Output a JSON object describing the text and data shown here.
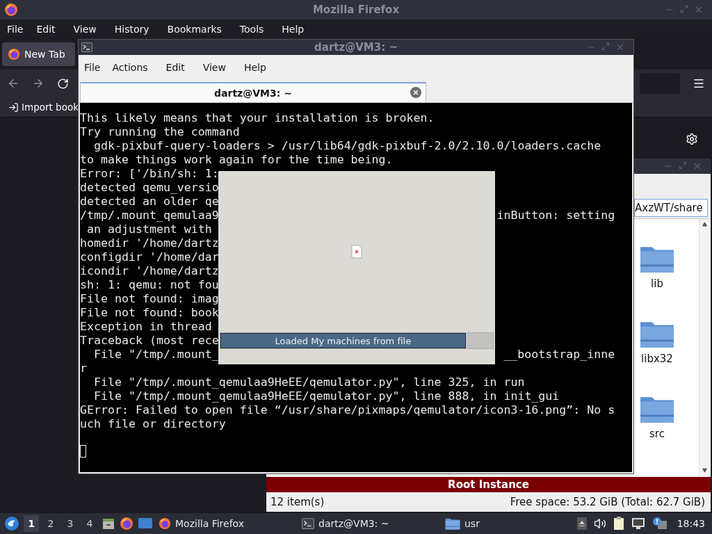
{
  "firefox": {
    "title": "Mozilla Firefox",
    "menu": [
      "File",
      "Edit",
      "View",
      "History",
      "Bookmarks",
      "Tools",
      "Help"
    ],
    "tab": {
      "label": "New Tab"
    },
    "bookmark": "Import book"
  },
  "terminal": {
    "title": "dartz@VM3: ~",
    "menu": [
      "File",
      "Actions",
      "Edit",
      "View",
      "Help"
    ],
    "tab": {
      "title": "dartz@VM3: ~"
    },
    "lines": [
      {
        "text": "This likely means that your installation is broken."
      },
      {
        "text": "Try running the command"
      },
      {
        "text": "  gdk-pixbuf-query-loaders > /usr/lib64/gdk-pixbuf-2.0/2.10.0/loaders.cache"
      },
      {
        "text": "to make things work again for the time being."
      },
      {
        "text": "Error: ['/bin/sh: 1:"
      },
      {
        "text": "detected qemu_versio"
      },
      {
        "text": "detected an older qe"
      },
      {
        "text": "/tmp/.mount_qemulaa9",
        "right": "inButton: setting"
      },
      {
        "text": " an adjustment with"
      },
      {
        "text": "homedir '/home/dartz"
      },
      {
        "text": "configdir '/home/dar"
      },
      {
        "text": "icondir '/home/dartz"
      },
      {
        "text": "sh: 1: qemu: not fou"
      },
      {
        "text": "File not found: imag"
      },
      {
        "text": "File not found: book"
      },
      {
        "text": "Exception in thread"
      },
      {
        "text": "Traceback (most rece"
      },
      {
        "text": "  File \"/tmp/.mount_",
        "right": "__bootstrap_inne"
      },
      {
        "text": "r"
      },
      {
        "text": "  File \"/tmp/.mount_qemulaa9HeEE/qemulator.py\", line 325, in run"
      },
      {
        "text": "  File \"/tmp/.mount_qemulaa9HeEE/qemulator.py\", line 888, in init_gui"
      },
      {
        "text": "GError: Failed to open file “/usr/share/pixmaps/qemulator/icon3-16.png”: No s"
      },
      {
        "text": "uch file or directory"
      }
    ]
  },
  "splash": {
    "status": "Loaded My machines from file",
    "level": 0.9
  },
  "file_manager": {
    "path": "AxzWT/share",
    "items": [
      {
        "name": "lib"
      },
      {
        "name": "libx32"
      },
      {
        "name": "src"
      }
    ],
    "instance": "Root Instance",
    "item_count": "12 item(s)",
    "free_space": "Free space: 53.2 GiB (Total: 62.7 GiB)"
  },
  "taskbar": {
    "workspaces": [
      {
        "label": "1",
        "selected": true
      },
      {
        "label": "2",
        "selected": false
      },
      {
        "label": "3",
        "selected": false
      },
      {
        "label": "4",
        "selected": false
      }
    ],
    "windows": [
      {
        "kind": "browser",
        "title": "Mozilla Firefox"
      },
      {
        "kind": "terminal",
        "title": "dartz@VM3: ~"
      },
      {
        "kind": "folder",
        "title": "usr"
      }
    ],
    "clock": "18:43"
  }
}
